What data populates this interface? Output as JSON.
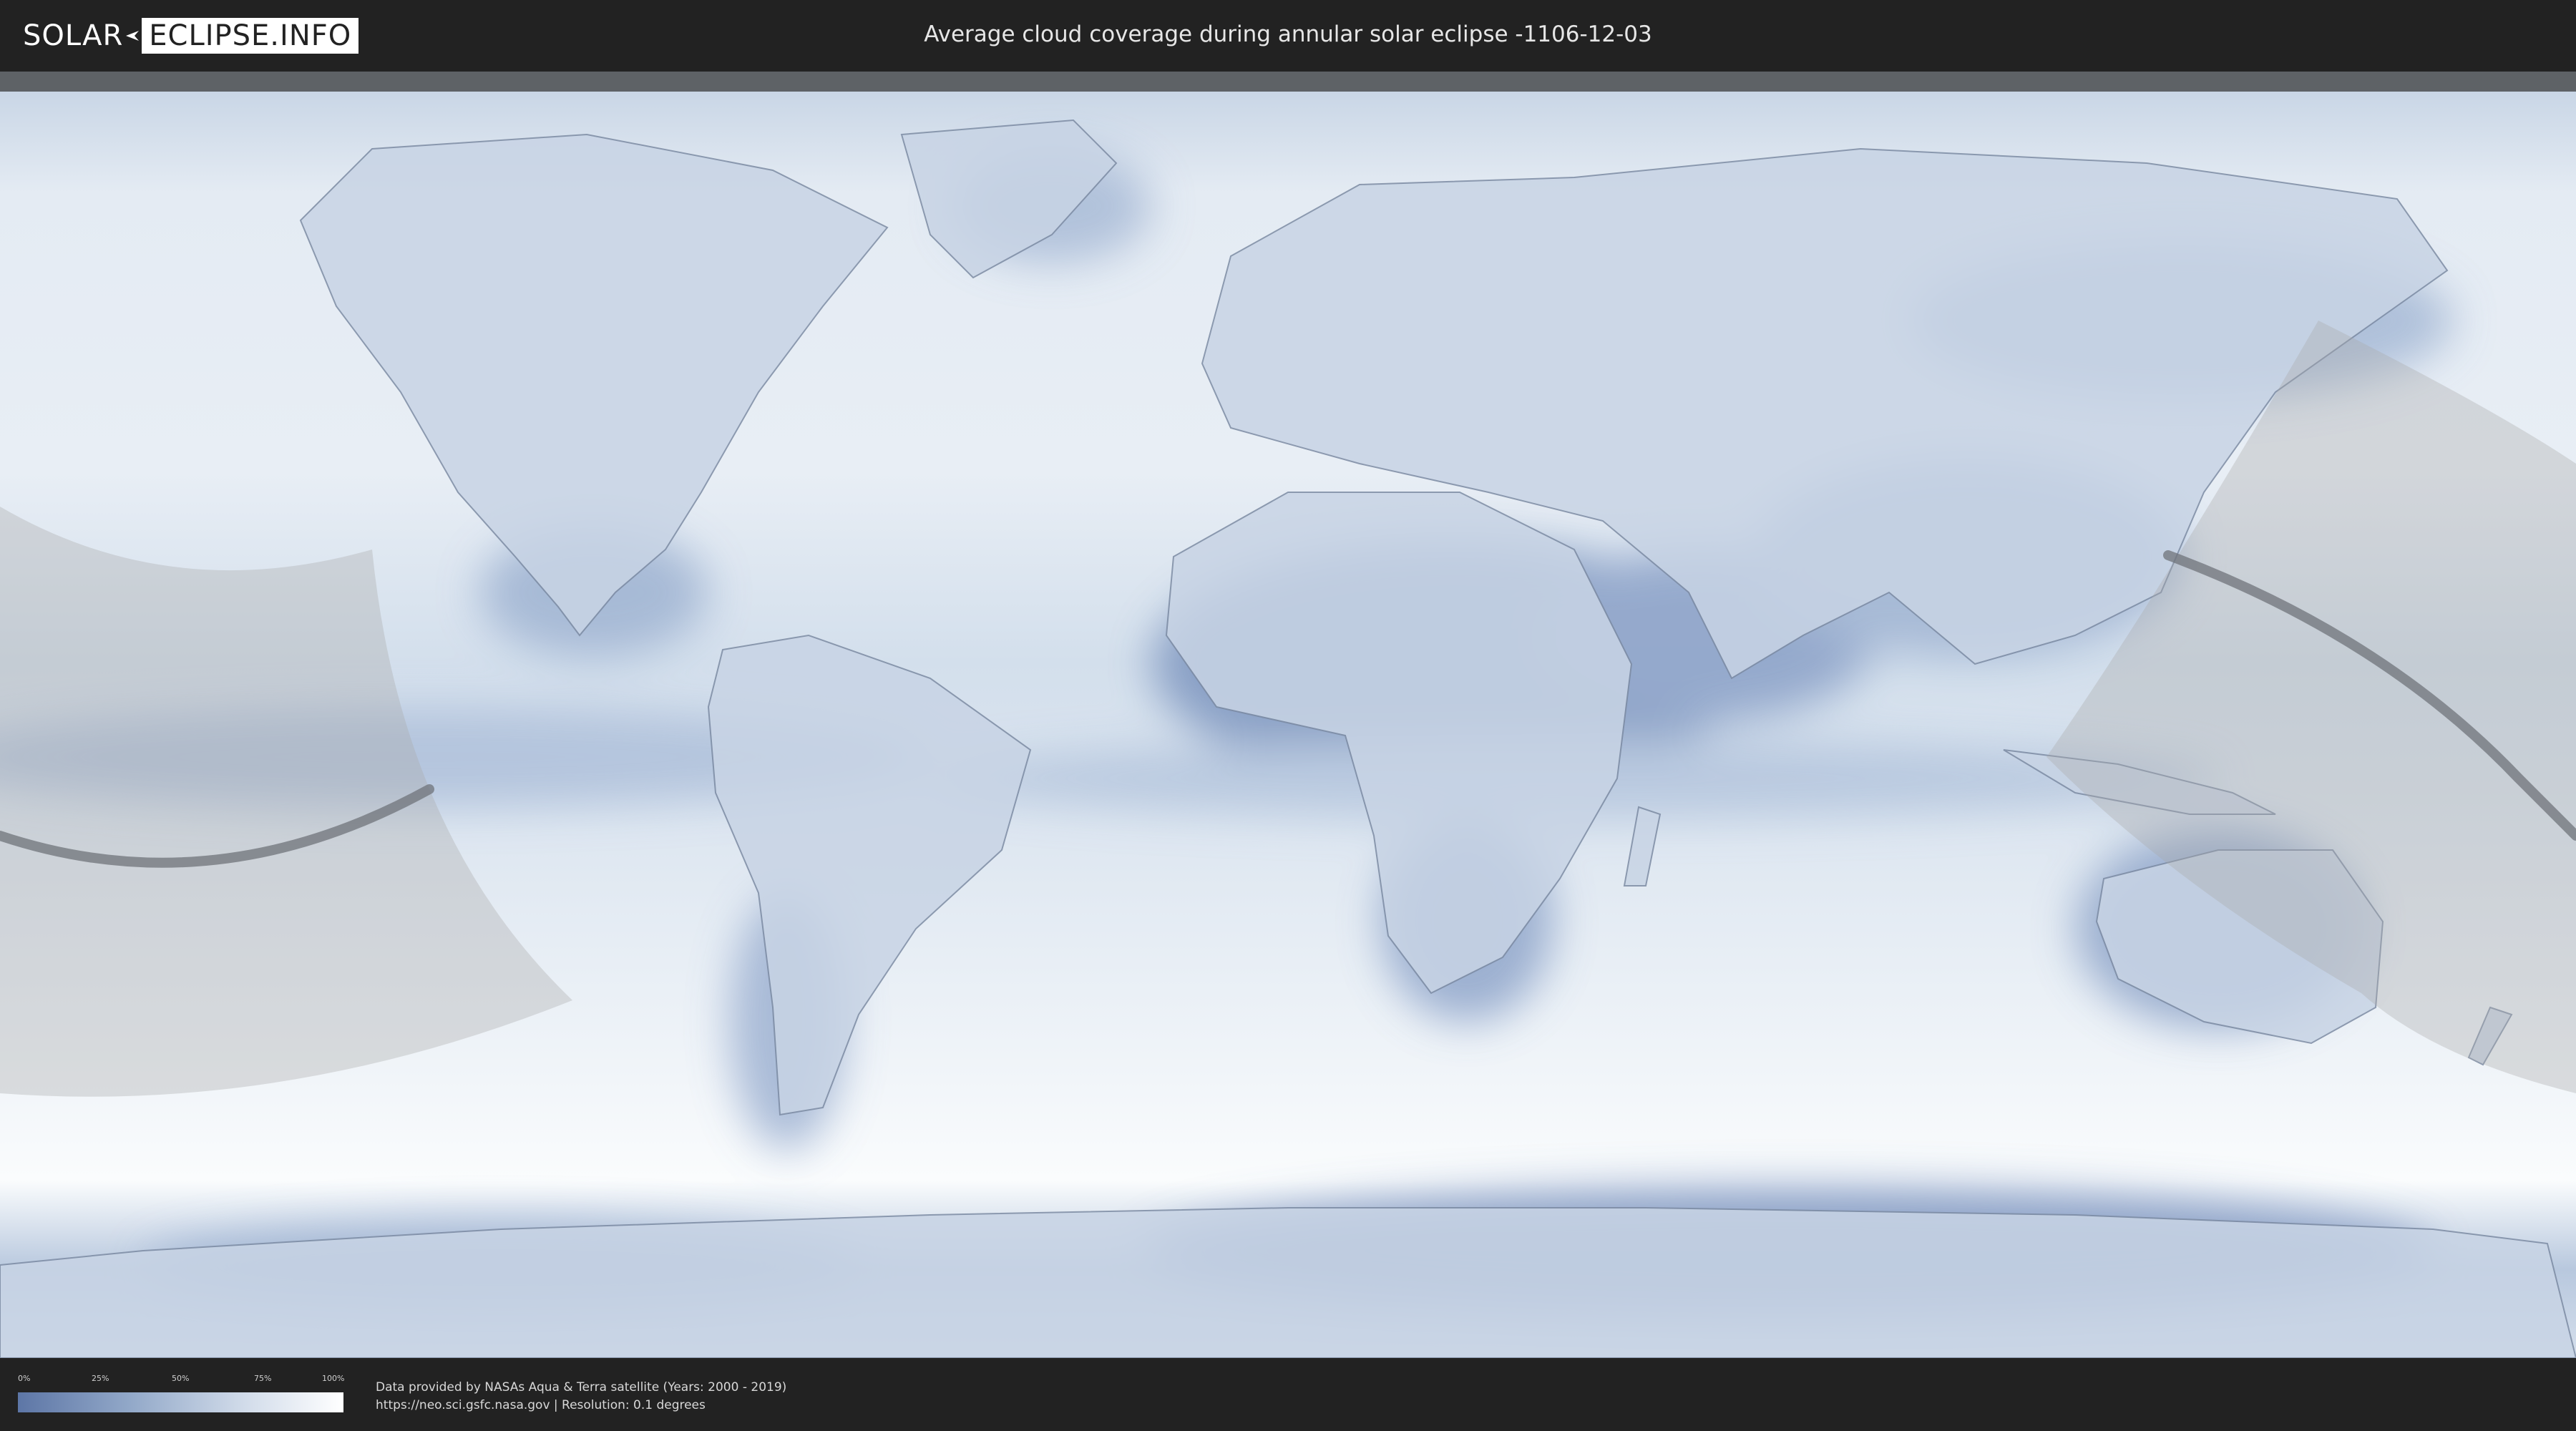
{
  "header": {
    "logo_solar": "SOLAR",
    "logo_eclipse": "ECLIPSE.INFO",
    "title": "Average cloud coverage during annular solar eclipse -1106-12-03"
  },
  "map": {
    "projection": "equirectangular",
    "colors": {
      "ocean_clear": "#eef3f8",
      "cloud_low": "#6d86b3",
      "cloud_mid": "#a9bcd7",
      "eclipse_zone": "#a8a8a8",
      "central_path": "#6f7379"
    }
  },
  "legend": {
    "ticks": [
      "0%",
      "25%",
      "50%",
      "75%",
      "100%"
    ],
    "gradient_colors": [
      "#5d76a6",
      "#93a9c9",
      "#d2dcea",
      "#ffffff"
    ]
  },
  "footer": {
    "source_line": "Data provided by NASAs Aqua & Terra satellite (Years: 2000 - 2019)",
    "url_line": "https://neo.sci.gsfc.nasa.gov | Resolution: 0.1 degrees"
  }
}
